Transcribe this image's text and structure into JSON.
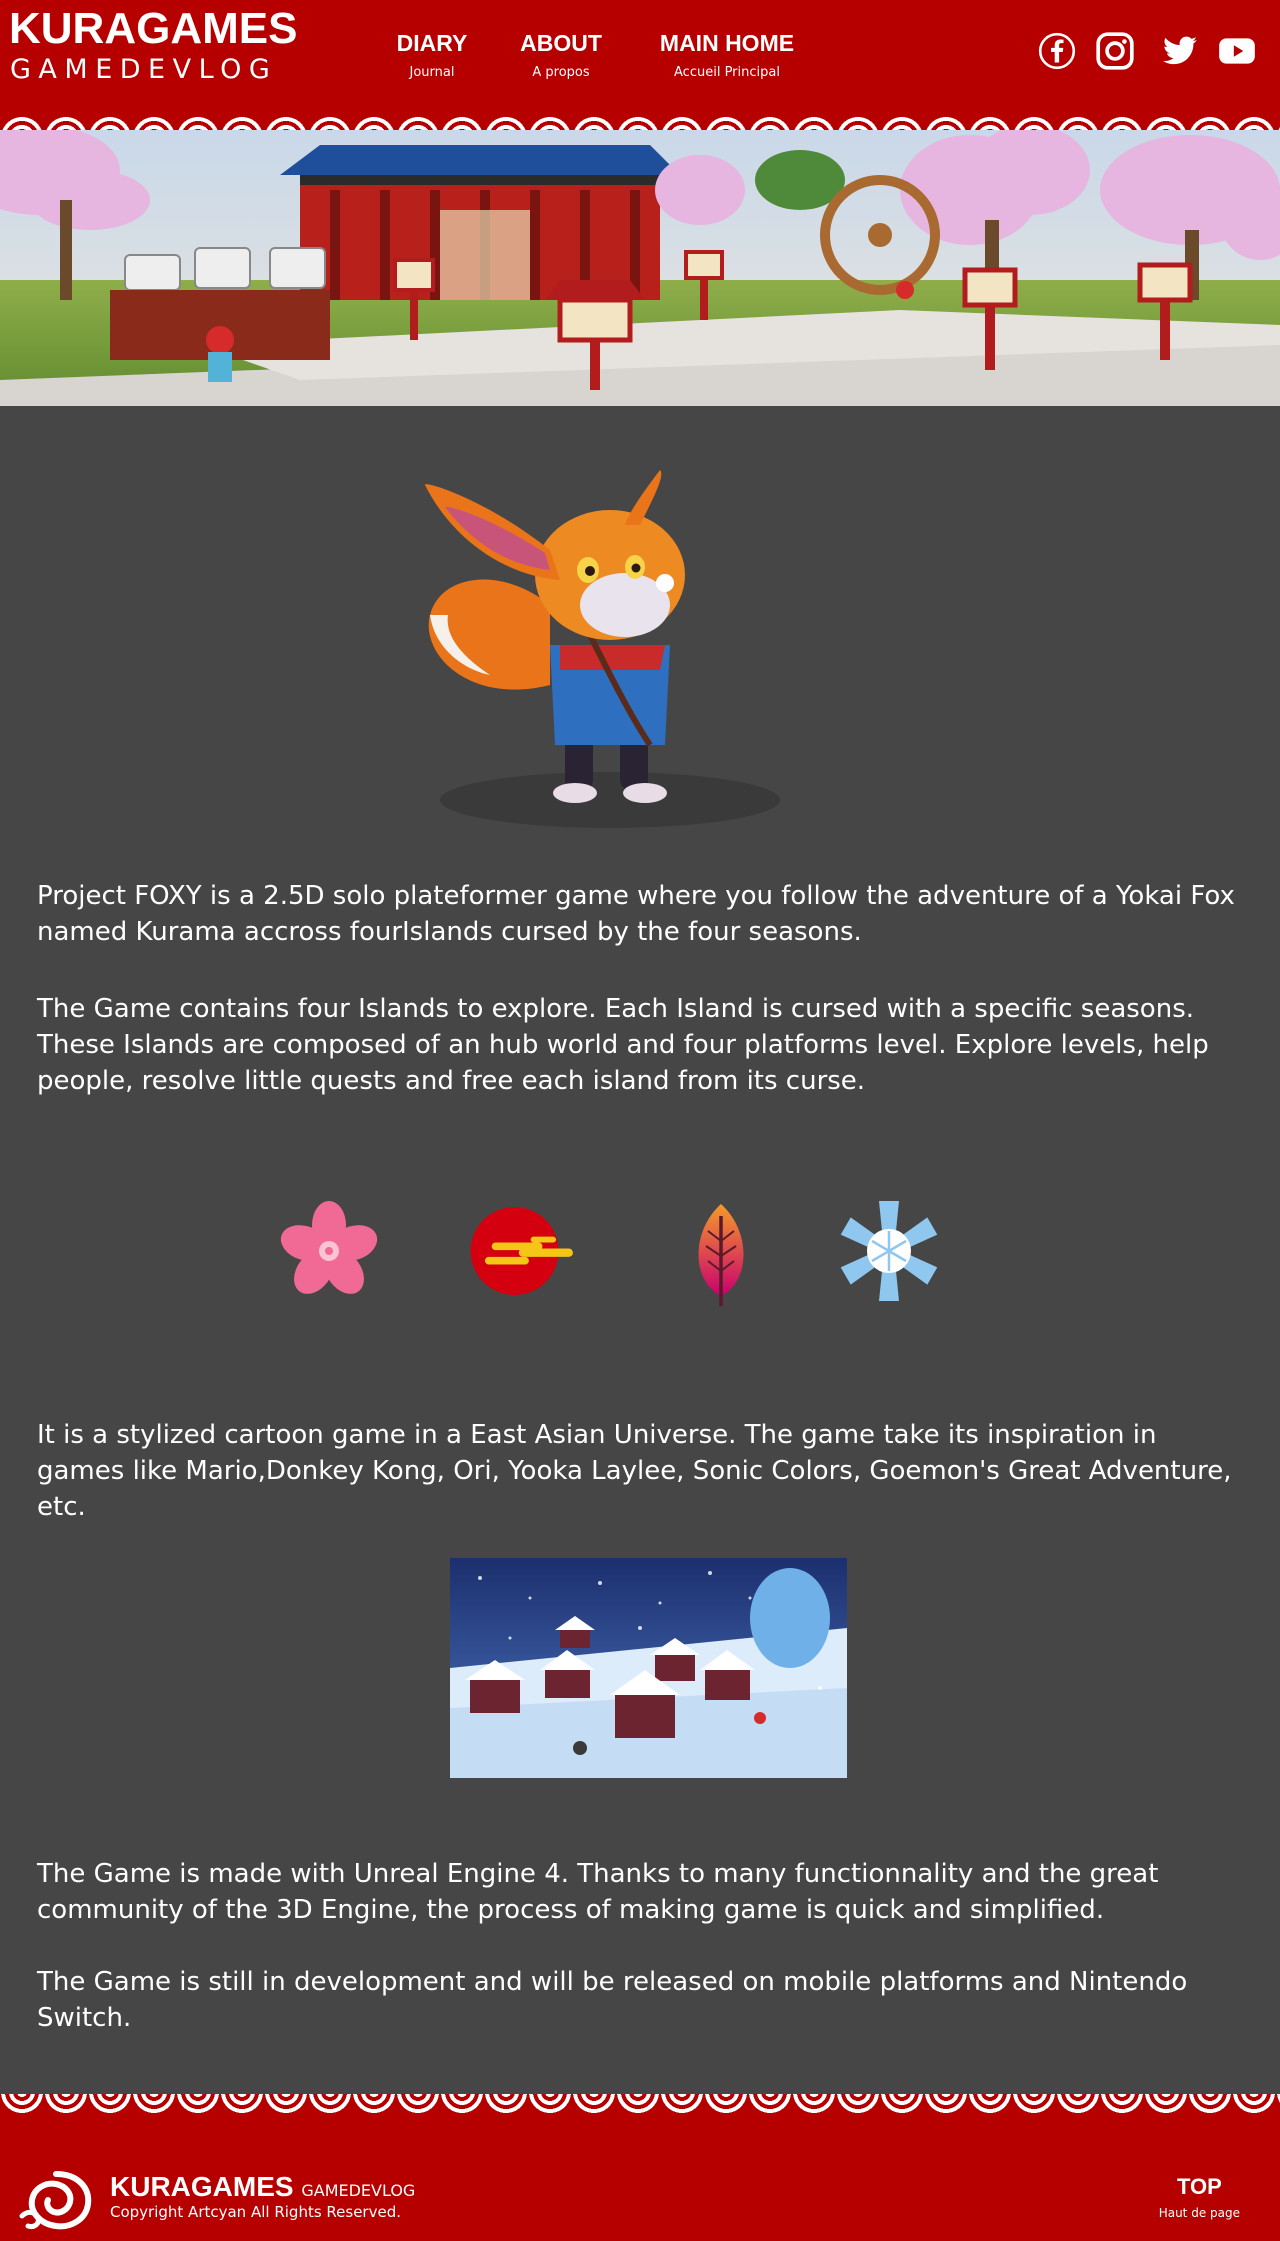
{
  "header": {
    "logo_title": "KURAGAMES",
    "logo_subtitle": "GAMEDEVLOG",
    "nav": [
      {
        "label": "DIARY",
        "sublabel": "Journal"
      },
      {
        "label": "ABOUT",
        "sublabel": "A propos"
      },
      {
        "label": "MAIN HOME",
        "sublabel": "Accueil Principal"
      }
    ],
    "social_icons": [
      "facebook-icon",
      "instagram-icon",
      "twitter-icon",
      "youtube-icon"
    ]
  },
  "content": {
    "paragraphs": [
      "Project FOXY is a 2.5D solo plateformer game where you follow the adventure of a Yokai Fox named Kurama accross fourIslands cursed by the four seasons.",
      "The Game contains four Islands to explore. Each Island is cursed with a specific seasons. These Islands are composed of an hub world and four platforms level. Explore levels, help people, resolve little quests and free each island from its curse.",
      "It is a stylized cartoon game in a East Asian Universe. The game take its inspiration in games like Mario,Donkey Kong, Ori, Yooka Laylee, Sonic Colors, Goemon's Great Adventure, etc.",
      "The Game is made with Unreal Engine 4. Thanks to many functionnality and the great community of the 3D Engine, the process of making game is quick and simplified.",
      "The Game is still in development and will be released on mobile platforms and Nintendo Switch."
    ],
    "season_icons": [
      "cherry-blossom-icon",
      "sun-icon",
      "autumn-leaf-icon",
      "snowflake-icon"
    ]
  },
  "footer": {
    "title": "KURAGAMES",
    "subtitle": "GAMEDEVLOG",
    "copyright": "Copyright Artcyan All Rights Reserved.",
    "top_label": "TOP",
    "top_sublabel": "Haut de page"
  },
  "colors": {
    "brand_red": "#b60000",
    "background": "#464646",
    "text": "#ffffff"
  }
}
